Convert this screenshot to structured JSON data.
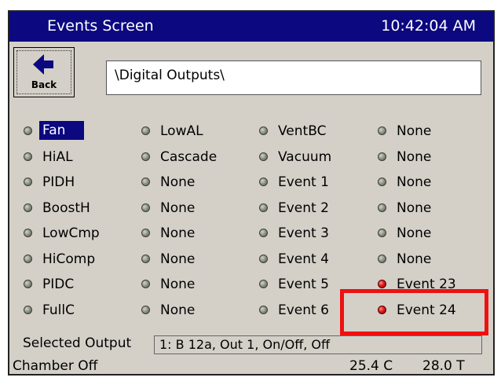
{
  "titlebar": {
    "title": "Events Screen",
    "time": "10:42:04 AM"
  },
  "back_button": {
    "label": "Back",
    "icon": "left-arrow-icon"
  },
  "path": "\\Digital Outputs\\",
  "columns": [
    [
      {
        "label": "Fan",
        "state": "off",
        "selected": true
      },
      {
        "label": "HiAL",
        "state": "off"
      },
      {
        "label": "PIDH",
        "state": "off"
      },
      {
        "label": "BoostH",
        "state": "off"
      },
      {
        "label": "LowCmp",
        "state": "off"
      },
      {
        "label": "HiComp",
        "state": "off"
      },
      {
        "label": "PIDC",
        "state": "off"
      },
      {
        "label": "FullC",
        "state": "off"
      }
    ],
    [
      {
        "label": "LowAL",
        "state": "off"
      },
      {
        "label": "Cascade",
        "state": "off"
      },
      {
        "label": "None",
        "state": "off"
      },
      {
        "label": "None",
        "state": "off"
      },
      {
        "label": "None",
        "state": "off"
      },
      {
        "label": "None",
        "state": "off"
      },
      {
        "label": "None",
        "state": "off"
      },
      {
        "label": "None",
        "state": "off"
      }
    ],
    [
      {
        "label": "VentBC",
        "state": "off"
      },
      {
        "label": "Vacuum",
        "state": "off"
      },
      {
        "label": "Event 1",
        "state": "off"
      },
      {
        "label": "Event 2",
        "state": "off"
      },
      {
        "label": "Event 3",
        "state": "off"
      },
      {
        "label": "Event 4",
        "state": "off"
      },
      {
        "label": "Event 5",
        "state": "off"
      },
      {
        "label": "Event 6",
        "state": "off"
      }
    ],
    [
      {
        "label": "None",
        "state": "off"
      },
      {
        "label": "None",
        "state": "off"
      },
      {
        "label": "None",
        "state": "off"
      },
      {
        "label": "None",
        "state": "off"
      },
      {
        "label": "None",
        "state": "off"
      },
      {
        "label": "None",
        "state": "off"
      },
      {
        "label": "Event 23",
        "state": "on"
      },
      {
        "label": "Event 24",
        "state": "on"
      }
    ]
  ],
  "selected_output": {
    "label": "Selected Output",
    "value": "1: B 12a, Out 1, On/Off, Off"
  },
  "status": {
    "chamber": "Chamber Off",
    "temp1": "25.4 C",
    "temp2": "28.0 T"
  },
  "colors": {
    "titlebar_bg": "#0b0880",
    "panel_bg": "#d4d0c8",
    "led_on": "#e01818",
    "led_off": "#8c9183",
    "highlight": "#ee1111"
  }
}
